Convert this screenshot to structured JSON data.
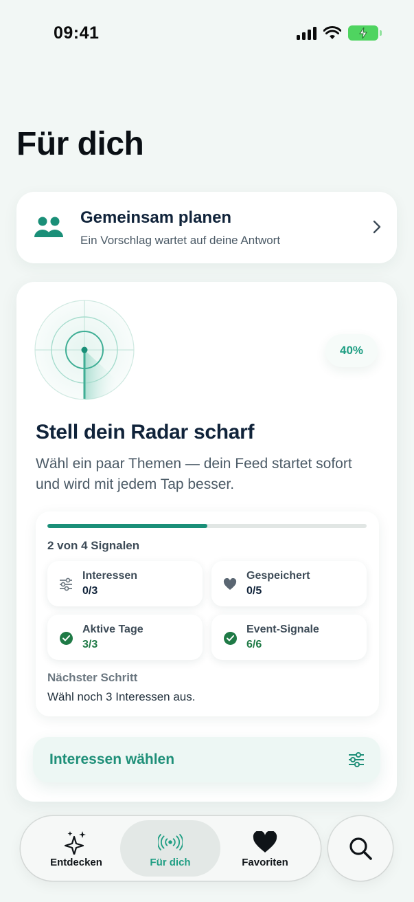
{
  "status_bar": {
    "time": "09:41"
  },
  "page": {
    "title": "Für dich"
  },
  "plan_card": {
    "title": "Gemeinsam planen",
    "subtitle": "Ein Vorschlag wartet auf deine Antwort",
    "icon": "people-icon"
  },
  "radar": {
    "percent": "40%",
    "title": "Stell dein Radar scharf",
    "description": "Wähl ein paar Themen — dein Feed startet sofort und wird mit jedem Tap besser.",
    "progress": {
      "fraction": 0.5,
      "label": "2 von 4 Signalen"
    },
    "tiles": [
      {
        "label": "Interessen",
        "value": "0/3",
        "icon": "sliders-icon",
        "done": false
      },
      {
        "label": "Gespeichert",
        "value": "0/5",
        "icon": "heart-icon",
        "done": false
      },
      {
        "label": "Aktive Tage",
        "value": "3/3",
        "icon": "check-icon",
        "done": true
      },
      {
        "label": "Event-Signale",
        "value": "6/6",
        "icon": "check-icon",
        "done": true
      }
    ],
    "next_step": {
      "label": "Nächster Schritt",
      "text": "Wähl noch 3 Interessen aus."
    },
    "cta": {
      "label": "Interessen wählen",
      "icon": "sliders-icon"
    }
  },
  "tabbar": {
    "tabs": [
      {
        "label": "Entdecken",
        "icon": "sparkles-icon",
        "active": false
      },
      {
        "label": "Für dich",
        "icon": "radio-waves-icon",
        "active": true
      },
      {
        "label": "Favoriten",
        "icon": "heart-icon",
        "active": false
      }
    ],
    "search_icon": "search-icon"
  },
  "colors": {
    "accent": "#1e9e83",
    "accent_dark": "#1a8f78",
    "success": "#1f7a46",
    "text": "#10233a",
    "background": "#f2f7f5"
  }
}
